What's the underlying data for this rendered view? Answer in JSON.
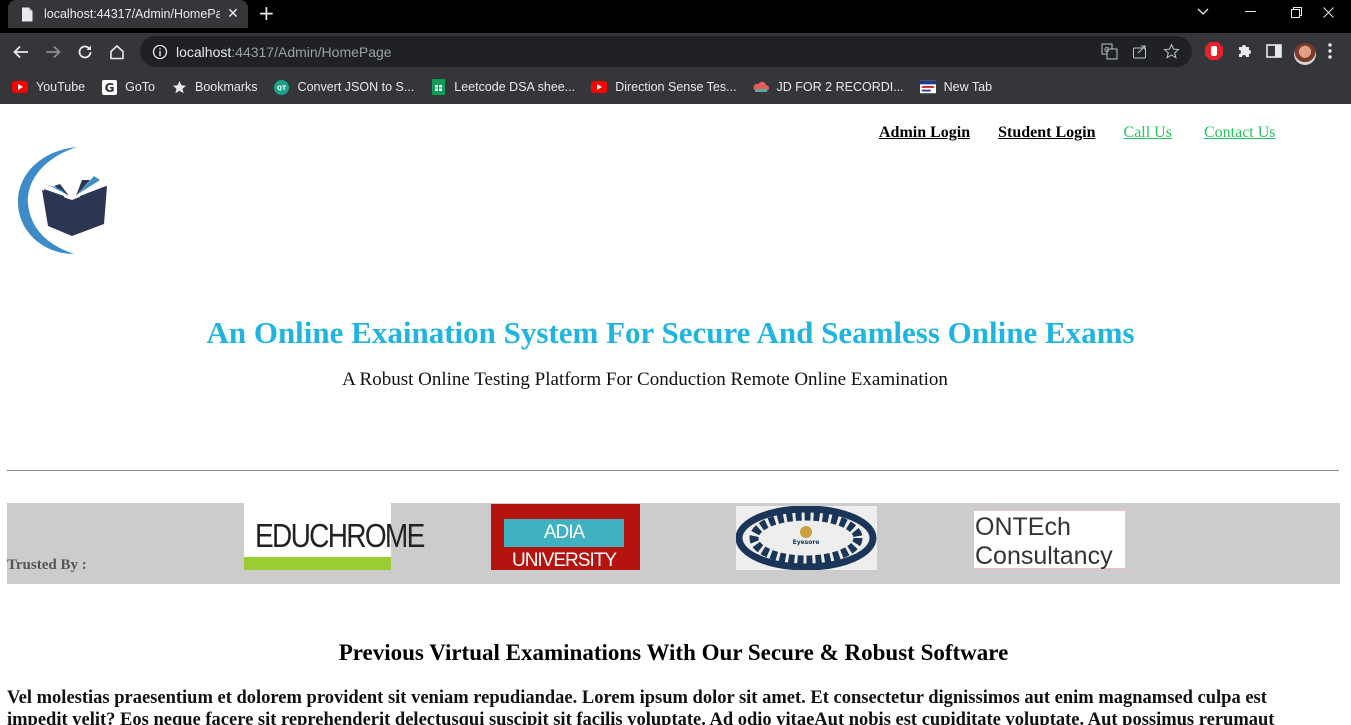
{
  "browser": {
    "tab_title": "localhost:44317/Admin/HomePage",
    "url_host": "localhost",
    "url_rest": ":44317/Admin/HomePage",
    "bookmarks": [
      {
        "label": "YouTube",
        "icon": "youtube-icon"
      },
      {
        "label": "GoTo",
        "icon": "google-icon"
      },
      {
        "label": "Bookmarks",
        "icon": "star-icon"
      },
      {
        "label": "Convert JSON to S...",
        "icon": "qt-icon"
      },
      {
        "label": "Leetcode DSA shee...",
        "icon": "sheets-icon"
      },
      {
        "label": "Direction Sense Tes...",
        "icon": "youtube-icon"
      },
      {
        "label": "JD FOR 2 RECORDI...",
        "icon": "cloud-icon"
      },
      {
        "label": "New Tab",
        "icon": "newtab-icon"
      }
    ]
  },
  "nav": {
    "admin_login": "Admin Login",
    "student_login": "Student Login",
    "call_us": "Call Us",
    "contact_us": "Contact Us"
  },
  "hero": {
    "title": "An Online Exaination System For Secure And Seamless Online Exams",
    "subtitle": "A Robust Online Testing Platform For Conduction Remote Online Examination"
  },
  "trusted": {
    "label": "Trusted By :",
    "brands": {
      "educhrome": "EDUCHROME",
      "adia": "ADIA UNIVERSITY",
      "eye": "Eyesore",
      "ontech_line1": "ONTEch",
      "ontech_line2": "Consultancy"
    }
  },
  "previous": {
    "title": "Previous Virtual Examinations With Our Secure & Robust Software",
    "body": "Vel molestias praesentium et dolorem provident sit veniam repudiandae. Lorem ipsum dolor sit amet. Et consectetur dignissimos aut enim magnamsed culpa est impedit velit? Eos neque facere sit reprehenderit delectusqui suscipit sit facilis voluptate. Ad odio vitaeAut nobis est cupiditate voluptate. Aut possimus rerumaut"
  },
  "colors": {
    "hero_title": "#1fb5e0",
    "nav_green": "#22c55e",
    "trusted_band": "#cccccc"
  }
}
